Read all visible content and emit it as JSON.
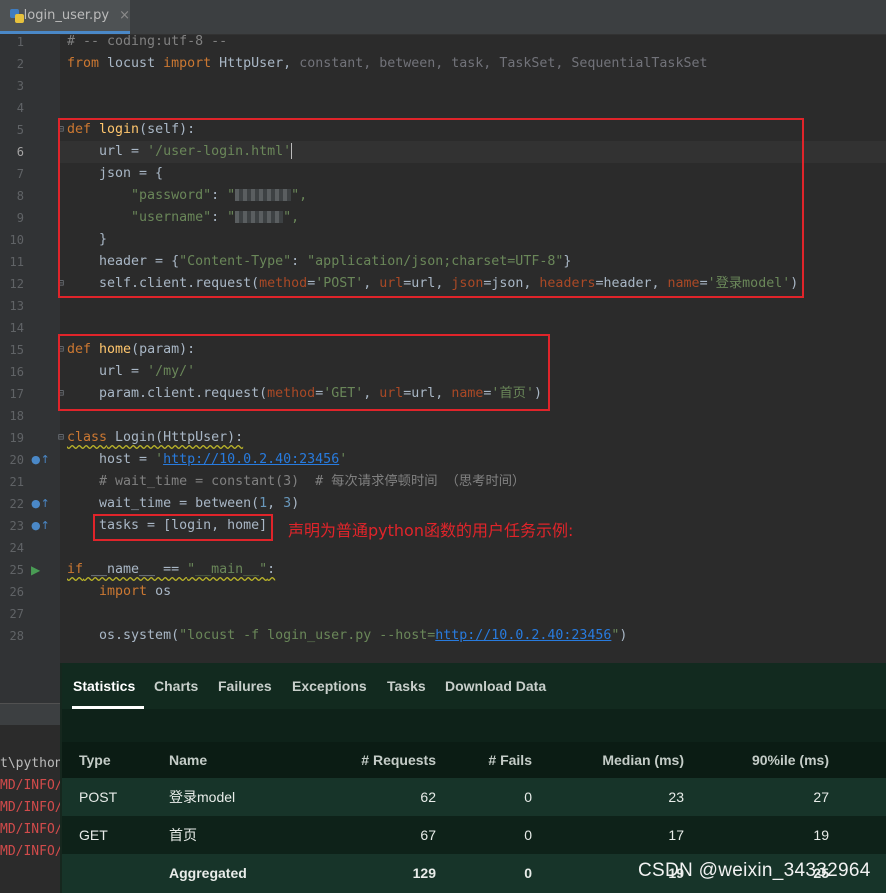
{
  "editor": {
    "tab": {
      "filename": "login_user.py",
      "close": "×"
    },
    "lines": {
      "l1": "# -- coding:utf-8 --",
      "l2": {
        "from": "from",
        "mod": " locust ",
        "imp": "import",
        "cls": " HttpUser, ",
        "rest": "constant, between, task, TaskSet, SequentialTaskSet"
      },
      "l5": {
        "def": "def",
        "name": " login",
        "args": "(self):"
      },
      "l6": {
        "a": "    url = ",
        "s": "'/user-login.html'"
      },
      "l7": "    json = {",
      "l8": {
        "a": "        ",
        "s": "\"password\"",
        "b": ": ",
        "c": "\"",
        "d": "\","
      },
      "l9": {
        "a": "        ",
        "s": "\"username\"",
        "b": ": ",
        "c": "\"",
        "d": "\","
      },
      "l10": "    }",
      "l11": {
        "a": "    header = {",
        "k": "\"Content-Type\"",
        "b": ": ",
        "v": "\"application/json;charset=UTF-8\"",
        "c": "}"
      },
      "l12": {
        "a": "    self.client.request(",
        "p1": "method",
        "e1": "=",
        "v1": "'POST'",
        "c1": ", ",
        "p2": "url",
        "e2": "=url, ",
        "p3": "json",
        "e3": "=json, ",
        "p4": "headers",
        "e4": "=header, ",
        "p5": "name",
        "e5": "=",
        "v5": "'登录model'",
        "z": ")"
      },
      "l15": {
        "def": "def",
        "name": " home",
        "args": "(param):"
      },
      "l16": {
        "a": "    url = ",
        "s": "'/my/'"
      },
      "l17": {
        "a": "    param.client.request(",
        "p1": "method",
        "e1": "=",
        "v1": "'GET'",
        "c1": ", ",
        "p2": "url",
        "e2": "=url, ",
        "p3": "name",
        "e3": "=",
        "v3": "'首页'",
        "z": ")"
      },
      "l19": {
        "cls": "class",
        "rest": " Login(HttpUser):"
      },
      "l20": {
        "a": "    host = ",
        "q1": "'",
        "url": "http://10.0.2.40:23456",
        "q2": "'"
      },
      "l21": "    # wait_time = constant(3)  # 每次请求停顿时间 （思考时间）",
      "l22": {
        "a": "    wait_time = between(",
        "n1": "1",
        "c": ", ",
        "n2": "3",
        "z": ")"
      },
      "l23": "    tasks = [login, home]",
      "l25": {
        "if": "if",
        "a": " __name__ == ",
        "s": "\"__main__\"",
        "z": ":"
      },
      "l26": {
        "a": "    ",
        "imp": "import",
        "m": " os"
      },
      "l28": {
        "a": "    os.system(",
        "s1": "\"locust -f login_user.py --host=",
        "url": "http://10.0.2.40:23456",
        "s2": "\"",
        "z": ")"
      }
    },
    "annotation": "声明为普通python函数的用户任务示例:"
  },
  "terminal": {
    "lines": [
      "t\\python",
      "MD/INFO/",
      "MD/INFO/",
      "MD/INFO/",
      "MD/INFO/"
    ]
  },
  "locust": {
    "tabs": [
      "Statistics",
      "Charts",
      "Failures",
      "Exceptions",
      "Tasks",
      "Download Data"
    ],
    "headers": [
      "Type",
      "Name",
      "# Requests",
      "# Fails",
      "Median (ms)",
      "90%ile (ms)"
    ],
    "rows": [
      {
        "type": "POST",
        "name": "登录model",
        "requests": "62",
        "fails": "0",
        "median": "23",
        "p90": "27"
      },
      {
        "type": "GET",
        "name": "首页",
        "requests": "67",
        "fails": "0",
        "median": "17",
        "p90": "19"
      },
      {
        "type": "",
        "name": "Aggregated",
        "requests": "129",
        "fails": "0",
        "median": "19",
        "p90": "25"
      }
    ]
  },
  "watermark": "CSDN @weixin_34332964",
  "colors": {
    "annotation_red": "#e0242a",
    "locust_bg": "#0e2219"
  }
}
